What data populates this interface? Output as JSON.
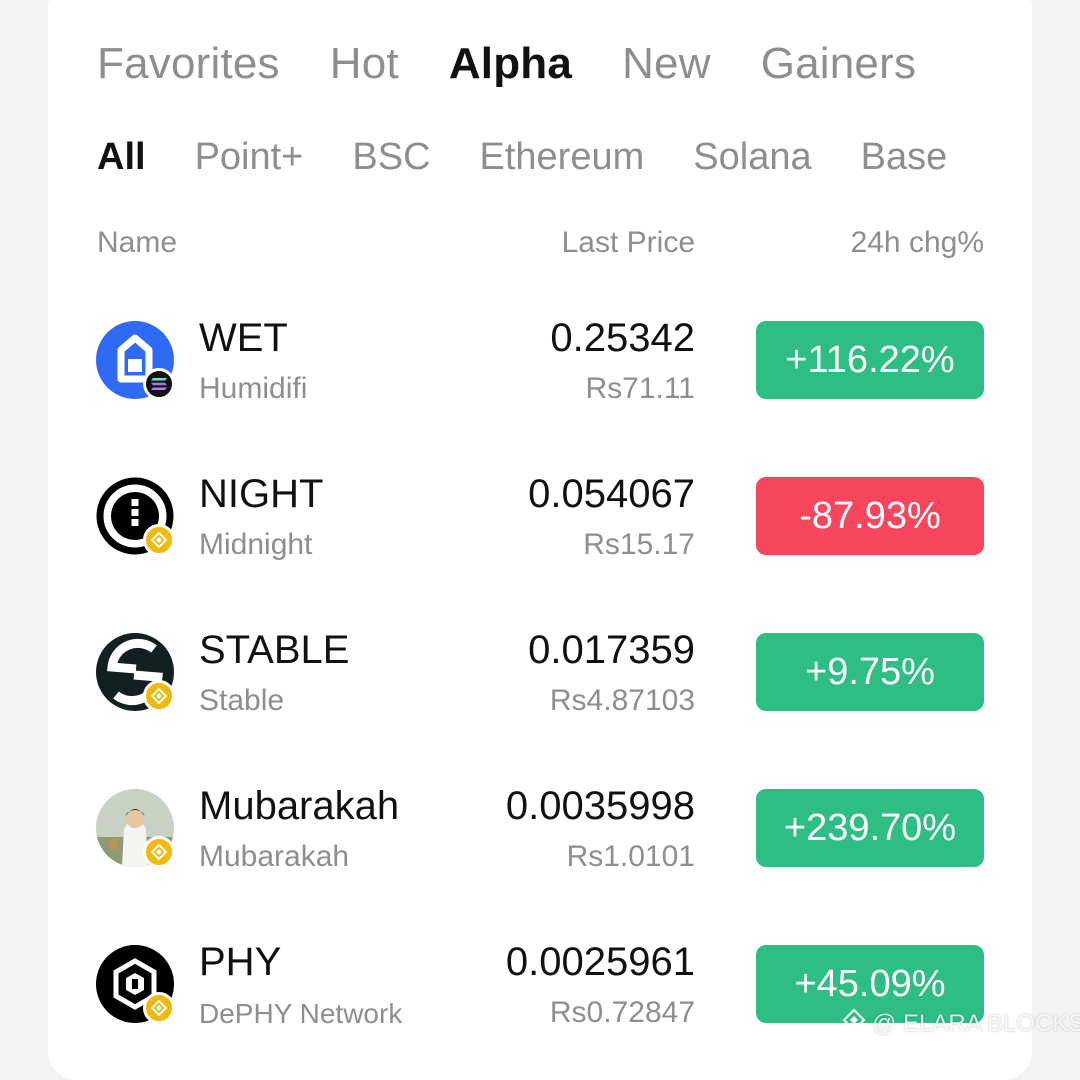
{
  "tabs_main": [
    {
      "label": "Favorites",
      "active": false
    },
    {
      "label": "Hot",
      "active": false
    },
    {
      "label": "Alpha",
      "active": true
    },
    {
      "label": "New",
      "active": false
    },
    {
      "label": "Gainers",
      "active": false
    }
  ],
  "tabs_sub": [
    {
      "label": "All",
      "active": true
    },
    {
      "label": "Point+",
      "active": false
    },
    {
      "label": "BSC",
      "active": false
    },
    {
      "label": "Ethereum",
      "active": false
    },
    {
      "label": "Solana",
      "active": false
    },
    {
      "label": "Base",
      "active": false
    }
  ],
  "columns": {
    "name": "Name",
    "last_price": "Last Price",
    "change": "24h chg%"
  },
  "rows": [
    {
      "symbol": "WET",
      "name": "Humidifi",
      "price": "0.25342",
      "fiat": "Rs71.11",
      "change": "+116.22%",
      "direction": "up",
      "chain": "solana-badge-icon",
      "logo": "humidifi-logo-icon"
    },
    {
      "symbol": "NIGHT",
      "name": "Midnight",
      "price": "0.054067",
      "fiat": "Rs15.17",
      "change": "-87.93%",
      "direction": "down",
      "chain": "bnb-badge-icon",
      "logo": "midnight-logo-icon"
    },
    {
      "symbol": "STABLE",
      "name": "Stable",
      "price": "0.017359",
      "fiat": "Rs4.87103",
      "change": "+9.75%",
      "direction": "up",
      "chain": "bnb-badge-icon",
      "logo": "stable-logo-icon"
    },
    {
      "symbol": "Mubarakah",
      "name": "Mubarakah",
      "price": "0.0035998",
      "fiat": "Rs1.0101",
      "change": "+239.70%",
      "direction": "up",
      "chain": "bnb-badge-icon",
      "logo": "mubarakah-avatar-icon"
    },
    {
      "symbol": "PHY",
      "name": "DePHY Network",
      "price": "0.0025961",
      "fiat": "Rs0.72847",
      "change": "+45.09%",
      "direction": "up",
      "chain": "bnb-badge-icon",
      "logo": "dephy-logo-icon"
    }
  ],
  "colors": {
    "up": "#2ebd85",
    "down": "#f6465d",
    "active_text": "#111111",
    "muted_text": "#8e8e8e"
  },
  "watermark": "@ ELARA BLOCKS"
}
